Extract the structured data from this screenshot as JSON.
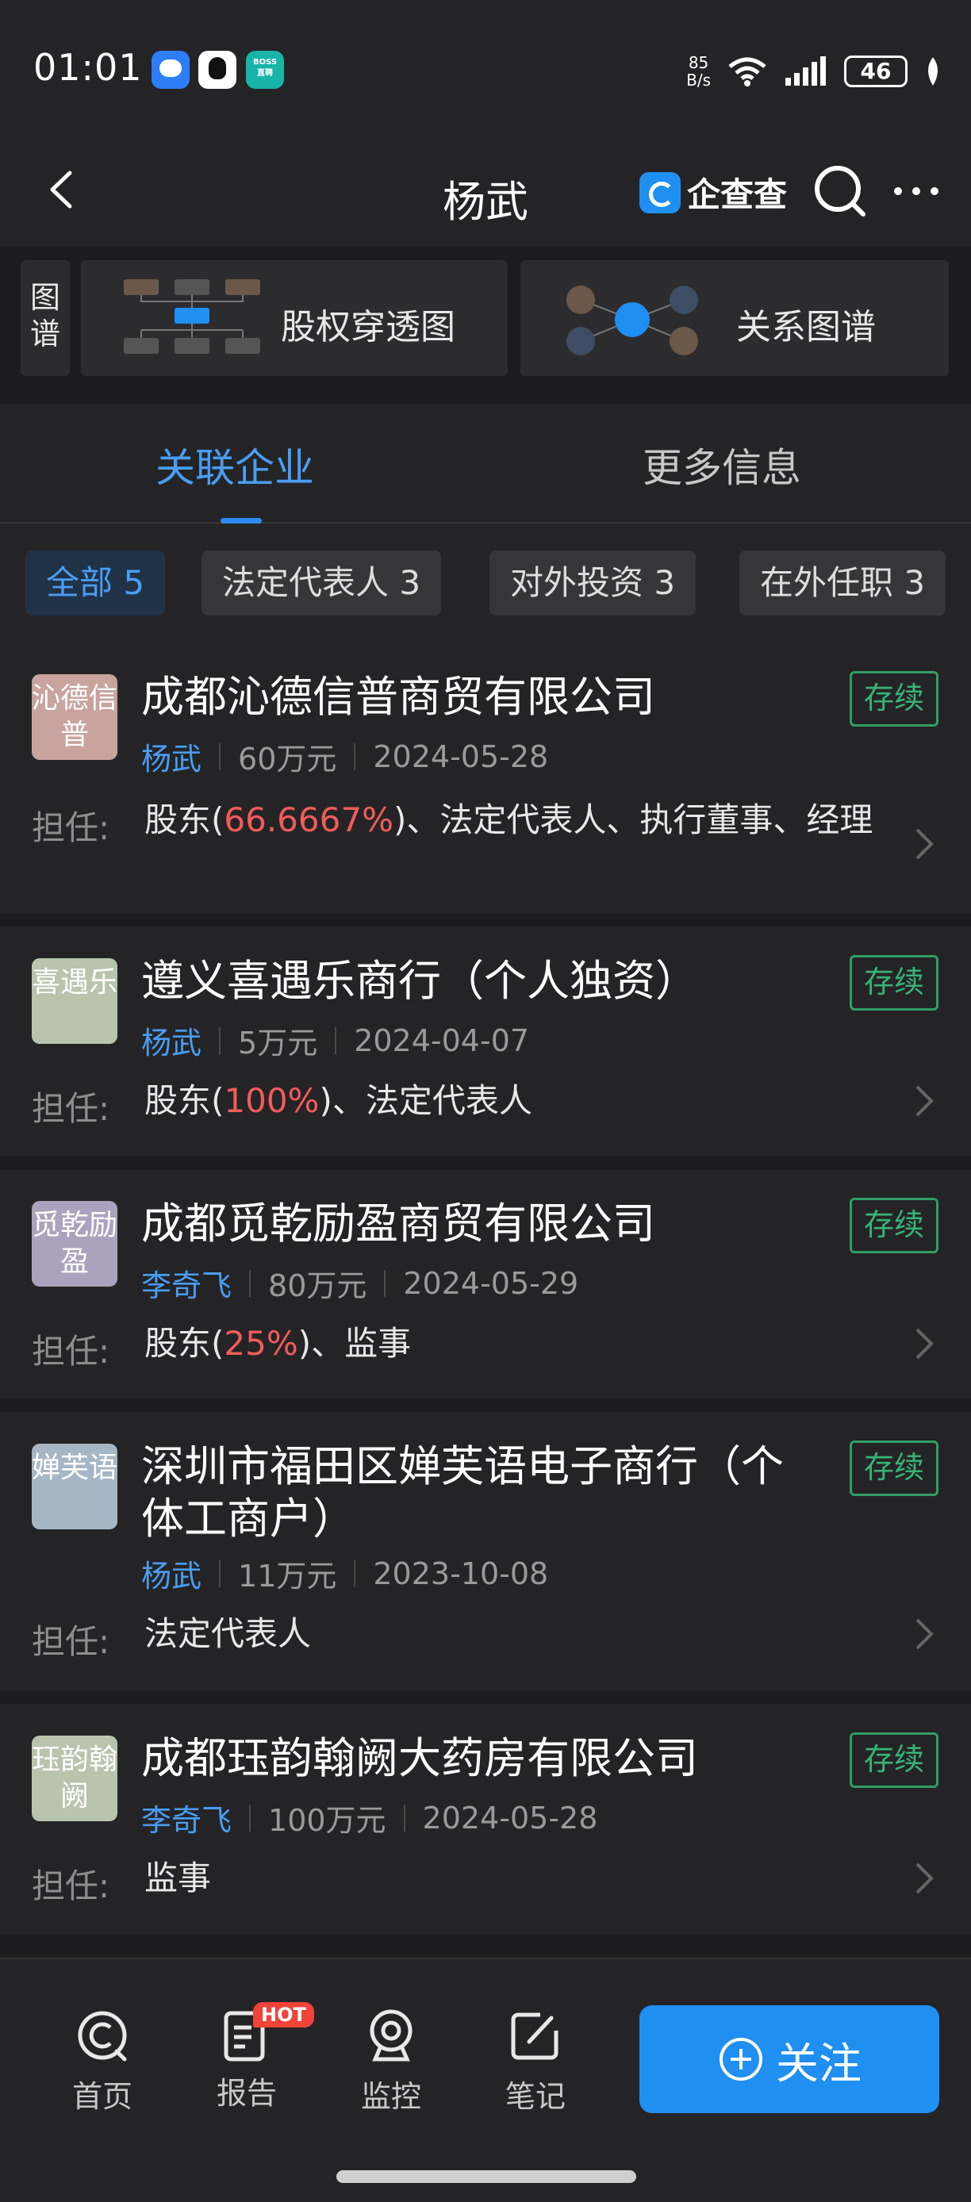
{
  "status_bar": {
    "time": "01:01",
    "net_speed_value": "85",
    "net_speed_unit": "B/s",
    "battery": "46",
    "boss_line1": "BOSS",
    "boss_line2": "直聘"
  },
  "header": {
    "title": "杨武",
    "brand": "企查查"
  },
  "graph_strip": {
    "label": "图谱",
    "equity_label": "股权穿透图",
    "relation_label": "关系图谱"
  },
  "tabs": [
    {
      "label": "关联企业",
      "active": true
    },
    {
      "label": "更多信息",
      "active": false
    }
  ],
  "filters": [
    {
      "label": "全部 5",
      "active": true
    },
    {
      "label": "法定代表人 3",
      "active": false
    },
    {
      "label": "对外投资 3",
      "active": false
    },
    {
      "label": "在外任职 3",
      "active": false
    }
  ],
  "role_label": "担任:",
  "companies": [
    {
      "logo": "沁德信普",
      "logo_color": "#c9a39e",
      "name": "成都沁德信普商贸有限公司",
      "status": "存续",
      "person": "杨武",
      "capital": "60万元",
      "date": "2024-05-28",
      "role_pre": "股东(",
      "role_pct": "66.6667%",
      "role_post": ")、法定代表人、执行董事、经理"
    },
    {
      "logo": "喜遇乐",
      "logo_color": "#b8c4ad",
      "name": "遵义喜遇乐商行（个人独资）",
      "status": "存续",
      "person": "杨武",
      "capital": "5万元",
      "date": "2024-04-07",
      "role_pre": "股东(",
      "role_pct": "100%",
      "role_post": ")、法定代表人"
    },
    {
      "logo": "觅乾励盈",
      "logo_color": "#aba3bd",
      "name": "成都觅乾励盈商贸有限公司",
      "status": "存续",
      "person": "李奇飞",
      "capital": "80万元",
      "date": "2024-05-29",
      "role_pre": "股东(",
      "role_pct": "25%",
      "role_post": ")、监事"
    },
    {
      "logo": "婵芙语",
      "logo_color": "#a7b6c4",
      "name": "深圳市福田区婵芙语电子商行（个体工商户）",
      "status": "存续",
      "person": "杨武",
      "capital": "11万元",
      "date": "2023-10-08",
      "role_pre": "法定代表人",
      "role_pct": "",
      "role_post": ""
    },
    {
      "logo": "珏韵翰阙",
      "logo_color": "#b8c4ad",
      "name": "成都珏韵翰阙大药房有限公司",
      "status": "存续",
      "person": "李奇飞",
      "capital": "100万元",
      "date": "2024-05-28",
      "role_pre": "监事",
      "role_pct": "",
      "role_post": ""
    }
  ],
  "bottom_nav": {
    "home": "首页",
    "report": "报告",
    "hot_badge": "HOT",
    "monitor": "监控",
    "notes": "笔记",
    "follow": "关注"
  },
  "colors": {
    "accent": "#1f8ff2",
    "status_green": "#38b277",
    "pct_red": "#f25b5b"
  }
}
